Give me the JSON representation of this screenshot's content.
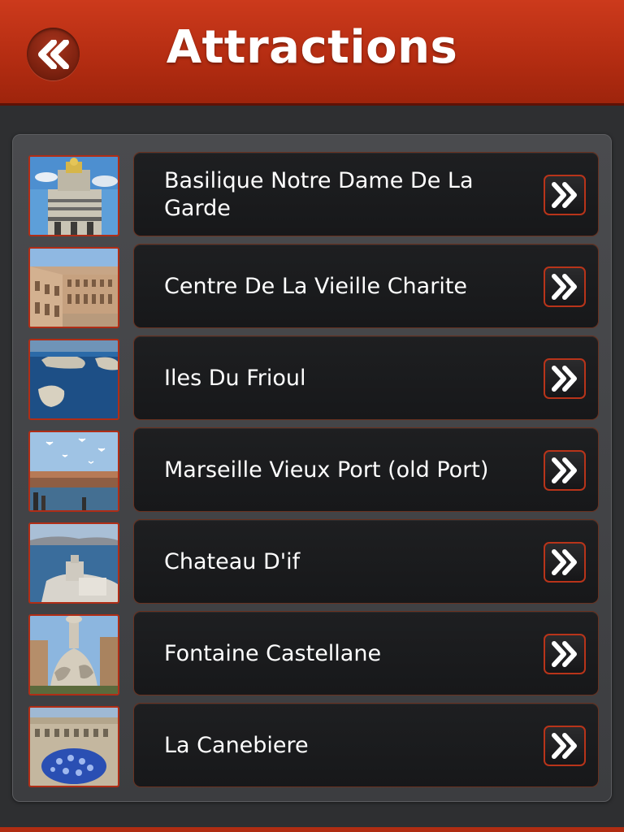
{
  "header": {
    "title": "Attractions",
    "back_icon": "double-chevron-left-icon"
  },
  "colors": {
    "header_red": "#b52d12",
    "accent_red": "#b8341a",
    "background": "#2e2f31",
    "item_background": "#1b1c1e",
    "text": "#ffffff"
  },
  "items": [
    {
      "label": "Basilique Notre Dame De La Garde",
      "thumbnail": "basilica-photo",
      "icon": "double-chevron-right-icon"
    },
    {
      "label": "Centre De La Vieille Charite",
      "thumbnail": "courtyard-photo",
      "icon": "double-chevron-right-icon"
    },
    {
      "label": "Iles Du Frioul",
      "thumbnail": "islands-photo",
      "icon": "double-chevron-right-icon"
    },
    {
      "label": "Marseille Vieux Port (old Port)",
      "thumbnail": "harbor-photo",
      "icon": "double-chevron-right-icon"
    },
    {
      "label": "Chateau D'if",
      "thumbnail": "castle-photo",
      "icon": "double-chevron-right-icon"
    },
    {
      "label": "Fontaine Castellane",
      "thumbnail": "fountain-photo",
      "icon": "double-chevron-right-icon"
    },
    {
      "label": "La Canebiere",
      "thumbnail": "street-photo",
      "icon": "double-chevron-right-icon"
    }
  ]
}
